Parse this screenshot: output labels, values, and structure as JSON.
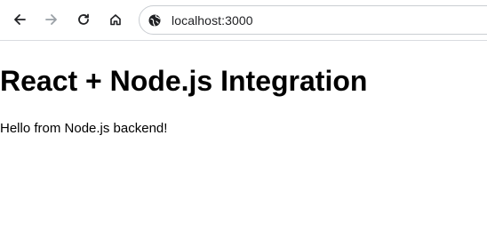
{
  "browser": {
    "url": "localhost:3000",
    "icons": {
      "back": "arrow-left-icon",
      "forward": "arrow-right-icon",
      "reload": "reload-icon",
      "home": "home-icon",
      "site_info": "globe-icon"
    },
    "colors": {
      "icon_active": "#202124",
      "icon_disabled": "#9aa0a6"
    }
  },
  "page": {
    "heading": "React + Node.js Integration",
    "message": "Hello from Node.js backend!"
  }
}
